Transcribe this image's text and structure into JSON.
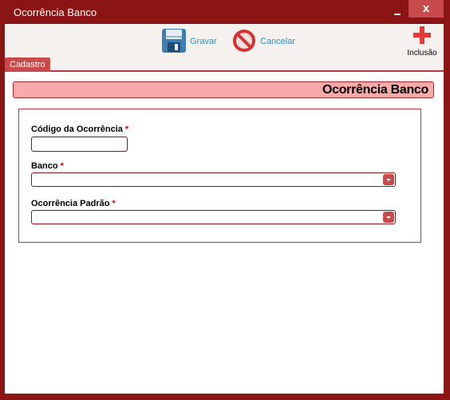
{
  "window": {
    "title": "Ocorrência Banco",
    "close_label": "x"
  },
  "toolbar": {
    "gravar_label": "Gravar",
    "cancelar_label": "Cancelar",
    "inclusao_label": "Inclusão"
  },
  "tabs": [
    {
      "label": "Cadastro"
    }
  ],
  "section": {
    "title": "Ocorrência Banco"
  },
  "form": {
    "codigo": {
      "label": "Código da Ocorrência",
      "required": "*",
      "value": ""
    },
    "banco": {
      "label": "Banco",
      "required": "*",
      "value": ""
    },
    "ocorrencia_padrao": {
      "label": "Ocorrência Padrão",
      "required": "*",
      "value": ""
    }
  },
  "icons": {
    "save": "floppy-disk-icon",
    "cancel": "no-entry-icon",
    "add": "plus-icon",
    "dropdown": "chevron-down-icon"
  },
  "colors": {
    "frame": "#8b1414",
    "accent": "#c84a4a",
    "header_bg": "#fbaaaa",
    "toolbar_bg": "#f5f1ee",
    "link": "#2a8fc7"
  }
}
